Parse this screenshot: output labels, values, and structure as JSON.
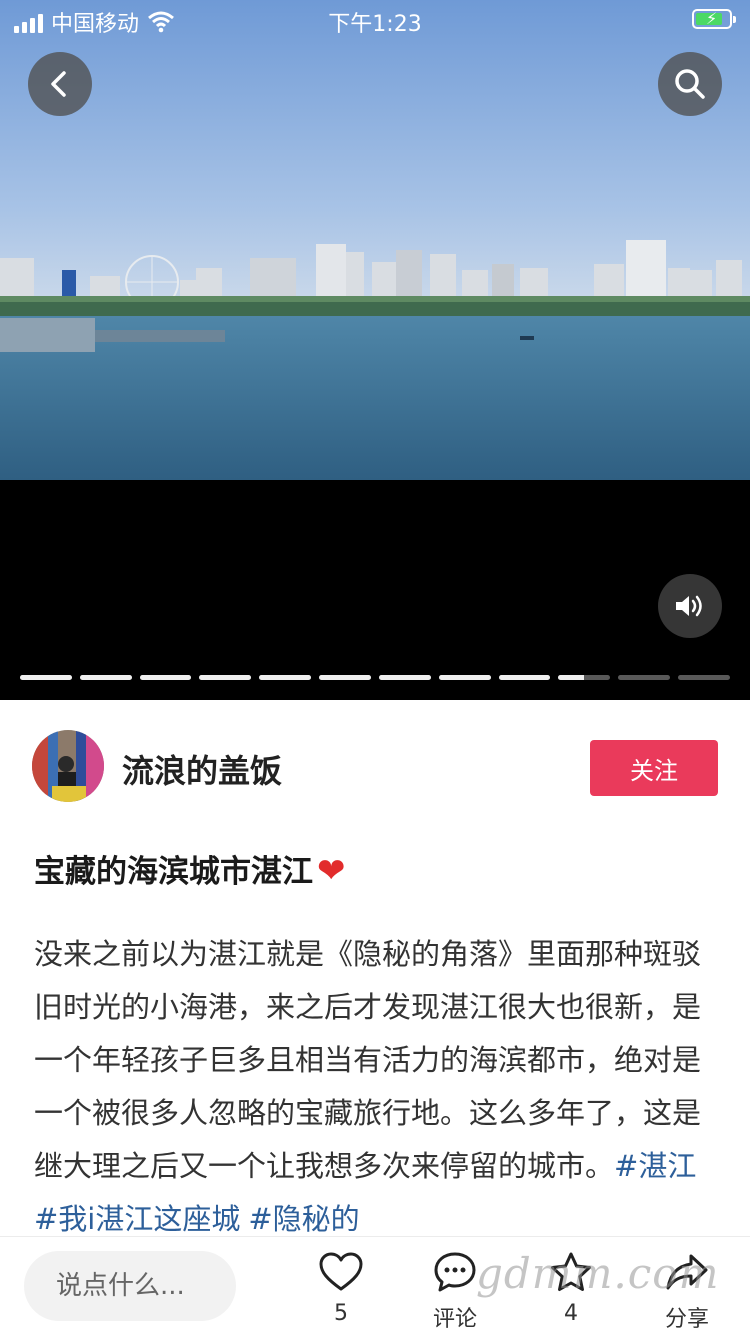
{
  "status_bar": {
    "carrier": "中国移动",
    "time": "下午1:23"
  },
  "media": {
    "progress": {
      "total_segments": 12,
      "current_segment": 10,
      "current_fill": 0.5
    }
  },
  "author": {
    "name": "流浪的盖饭",
    "follow_label": "关注"
  },
  "post": {
    "title": "宝藏的海滨城市湛江",
    "title_emoji": "❤",
    "body": "没来之前以为湛江就是《隐秘的角落》里面那种斑驳旧时光的小海港，来之后才发现湛江很大也很新，是一个年轻孩子巨多且相当有活力的海滨都市，绝对是一个被很多人忽略的宝藏旅行地。这么多年了，这是继大理之后又一个让我想多次来停留的城市。",
    "tags": [
      "#湛江",
      "#我i湛江这座城",
      "#隐秘的"
    ]
  },
  "bottom_bar": {
    "comment_placeholder": "说点什么...",
    "like_count": "5",
    "comment_label": "评论",
    "star_count": "4",
    "share_label": "分享",
    "watermark": "gdmm.com"
  },
  "icons": {
    "back": "chevron-left-icon",
    "search": "search-icon",
    "sound": "speaker-icon",
    "like": "heart-icon",
    "comment": "comment-icon",
    "star": "star-icon",
    "share": "share-icon"
  },
  "colors": {
    "follow_button": "#ea3a5b",
    "hashtag": "#2d5f9a",
    "sky": "#7ea6dc",
    "sea": "#3f7295"
  }
}
